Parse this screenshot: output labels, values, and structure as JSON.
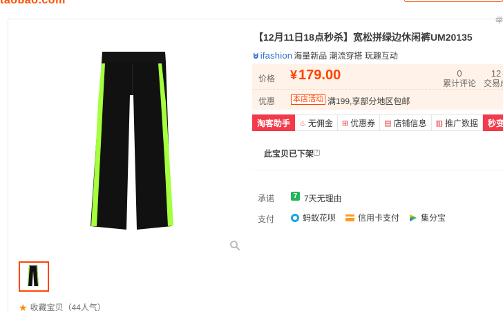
{
  "header": {
    "logo": "taobao.com",
    "corner_char": "举"
  },
  "product": {
    "title": "【12月11日18点秒杀】宽松拼绿边休闲裤UM20135",
    "brand": {
      "name": "ifashion",
      "slogan": "海量新品 潮流穿搭 玩趣互动"
    }
  },
  "price_panel": {
    "price_label": "价格",
    "currency": "¥",
    "price": "179.00",
    "reviews": {
      "count": "0",
      "label": "累计评论"
    },
    "trades": {
      "count": "12",
      "label": "交易成"
    },
    "promo_label": "优惠",
    "promo_tag": "本店活动",
    "promo_text": "满199,享部分地区包邮"
  },
  "actions": [
    {
      "label": "淘客助手",
      "style": "red",
      "icon": ""
    },
    {
      "label": "无佣金",
      "style": "plain",
      "icon": "♨"
    },
    {
      "label": "优惠券",
      "style": "plain",
      "icon": "⊞"
    },
    {
      "label": "店铺信息",
      "style": "plain",
      "icon": "▤"
    },
    {
      "label": "推广数据",
      "style": "plain",
      "icon": "▥"
    },
    {
      "label": "秒变手淘",
      "style": "red",
      "icon": ""
    }
  ],
  "status": {
    "offline_text": "此宝贝已下架",
    "help": "?"
  },
  "promise": {
    "label": "承诺",
    "badge": "7",
    "text": "7天无理由"
  },
  "payment": {
    "label": "支付",
    "methods": [
      {
        "label": "蚂蚁花呗",
        "icon": "huabei-icon"
      },
      {
        "label": "信用卡支付",
        "icon": "credit-card-icon"
      },
      {
        "label": "集分宝",
        "icon": "jifenbao-icon"
      }
    ]
  },
  "gallery": {
    "favorite_text": "收藏宝贝（44人气）"
  },
  "colors": {
    "accent": "#ff4400",
    "price_bg": "#fff2e8",
    "action_red": "#f23a4a",
    "trim_green": "#a4ff3c"
  }
}
